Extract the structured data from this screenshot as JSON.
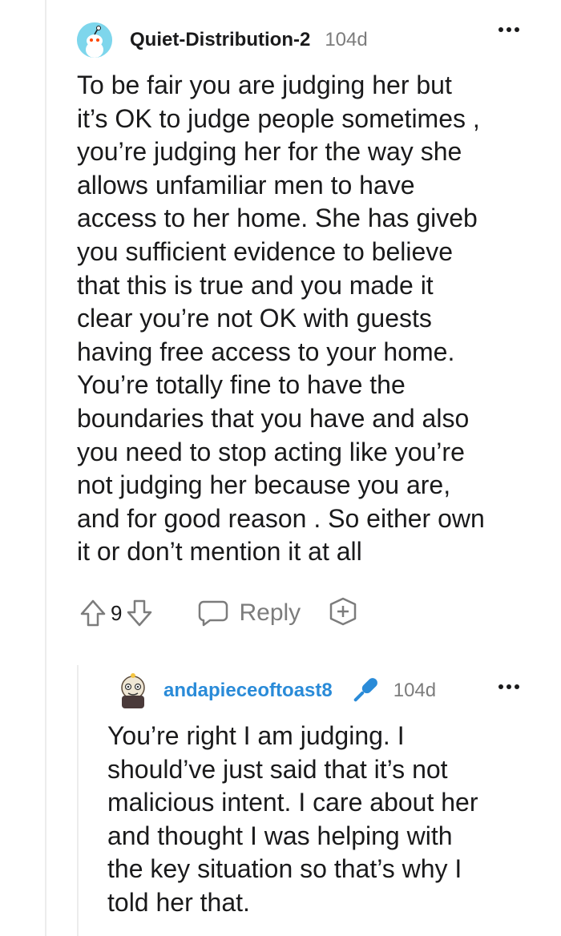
{
  "comment": {
    "username": "Quiet-Distribution-2",
    "age": "104d",
    "body": "To be fair you are judging her but\nit’s OK to judge people sometimes ,\nyou’re judging her for the way she\nallows unfamiliar men to have\naccess to her home. She has giveb\nyou sufficient evidence to believe\nthat this is true and you made it\nclear you’re not OK with guests\nhaving free access to your home.\nYou’re totally fine to have the\nboundaries that you have and also\nyou need to stop acting like you’re\nnot judging her because you are,\nand for good reason . So either own\nit or don’t mention it at all",
    "score": "9",
    "reply_label": "Reply",
    "icons": [
      "upvote-icon",
      "downvote-icon",
      "reply-bubble-icon",
      "award-icon",
      "more-options-icon"
    ]
  },
  "reply": {
    "username": "andapieceoftoast8",
    "age": "104d",
    "body": "You’re right I am judging. I\nshould’ve just said that it’s not\nmalicious intent. I care about her\nand thought I was helping with\nthe key situation so that’s why I\ntold her that.",
    "icons": [
      "op-microphone-icon",
      "more-options-icon"
    ]
  },
  "colors": {
    "avatar_bg": "#7ed6ec",
    "op_username": "#2a8bd8",
    "muted_text": "#7c7c7c",
    "text": "#1a1a1b"
  }
}
